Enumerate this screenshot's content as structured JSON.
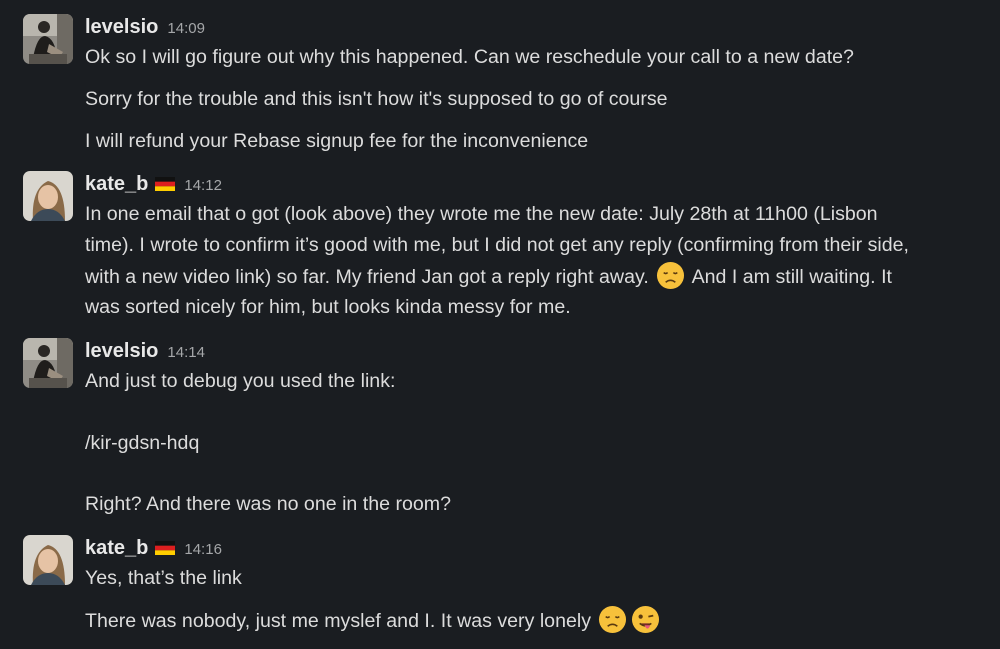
{
  "messages": [
    {
      "user": "levelsio",
      "time": "14:09",
      "lines": [
        "Ok so I will go figure out why this happened. Can we reschedule your call to a new date?",
        "Sorry for the trouble and this isn't how it's supposed to go of course",
        "I will refund your Rebase signup fee for the inconvenience"
      ]
    },
    {
      "user": "kate_b",
      "flag": "germany-flag",
      "time": "14:12",
      "lines": [
        "In one email that o got (look above) they wrote me the new date: July 28th at 11h00 (Lisbon",
        "time). I wrote to confirm it’s good with me, but I did not get any reply (confirming from their side,",
        "with a new video link) so far. My friend Jan got a reply right away.",
        "And I am still waiting. It",
        "was sorted nicely for him, but looks kinda messy for me."
      ],
      "inline_emoji": "disappointed-face-emoji"
    },
    {
      "user": "levelsio",
      "time": "14:14",
      "lines": [
        "And just to debug you used the link:",
        "/kir-gdsn-hdq",
        "Right? And there was no one in the room?"
      ]
    },
    {
      "user": "kate_b",
      "flag": "germany-flag",
      "time": "14:16",
      "lines": [
        "Yes, that’s the link",
        "There was nobody, just me myslef and I. It was very lonely"
      ],
      "trailing_emojis": [
        "disappointed-face-emoji",
        "winking-face-with-tongue-emoji"
      ]
    }
  ],
  "colors": {
    "background": "#1a1d21",
    "text": "#dcdcdc",
    "timestamp": "#a5a7a9",
    "emoji_face": "#f7c13b"
  }
}
